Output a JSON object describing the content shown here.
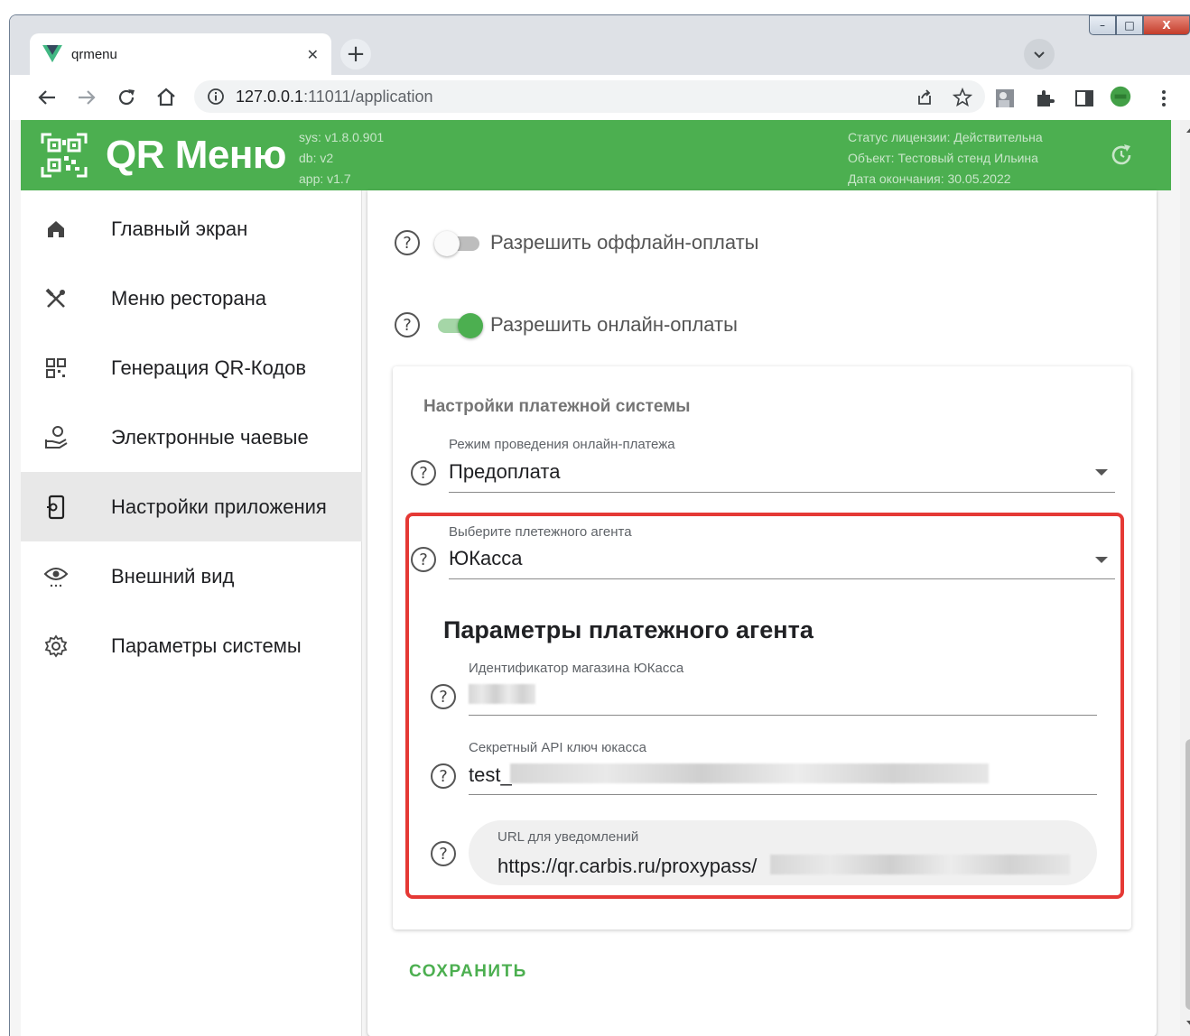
{
  "browser": {
    "tab_title": "qrmenu",
    "tab_close": "✕",
    "new_tab": "+",
    "url_host": "127.0.0.1",
    "url_rest": ":11011/application"
  },
  "window": {
    "minimize": "–",
    "maximize": "□",
    "close": "X"
  },
  "header": {
    "app_name": "QR Меню",
    "versions": [
      "sys: v1.8.0.901",
      "db: v2",
      "app: v1.7"
    ],
    "license": [
      "Статус лицензии: Действительна",
      "Объект: Тестовый стенд Ильина",
      "Дата окончания: 30.05.2022"
    ],
    "brand_color": "#4caf50"
  },
  "sidebar": {
    "items": [
      {
        "label": "Главный экран",
        "icon": "home-icon"
      },
      {
        "label": "Меню ресторана",
        "icon": "utensils-icon"
      },
      {
        "label": "Генерация QR-Кодов",
        "icon": "qr-code-icon"
      },
      {
        "label": "Электронные чаевые",
        "icon": "tip-hand-icon"
      },
      {
        "label": "Настройки приложения",
        "icon": "app-settings-icon",
        "active": true
      },
      {
        "label": "Внешний вид",
        "icon": "eye-icon"
      },
      {
        "label": "Параметры системы",
        "icon": "gear-icon"
      }
    ]
  },
  "content": {
    "offline_label": "Разрешить оффлайн-оплаты",
    "offline_enabled": false,
    "online_label": "Разрешить онлайн-оплаты",
    "online_enabled": true,
    "payment_card_title": "Настройки платежной системы",
    "mode_label": "Режим проведения онлайн-платежа",
    "mode_value": "Предоплата",
    "agent_label": "Выберите плетежного агента",
    "agent_value": "ЮКасса",
    "params_title": "Параметры платежного агента",
    "shop_id_label": "Идентификатор магазина ЮКасса",
    "secret_label": "Секретный API ключ юкасса",
    "secret_prefix": "test_",
    "url_label": "URL для уведомлений",
    "url_prefix": "https://qr.carbis.ru/proxypass/",
    "help_glyph": "?",
    "save_label": "СОХРАНИТЬ"
  }
}
